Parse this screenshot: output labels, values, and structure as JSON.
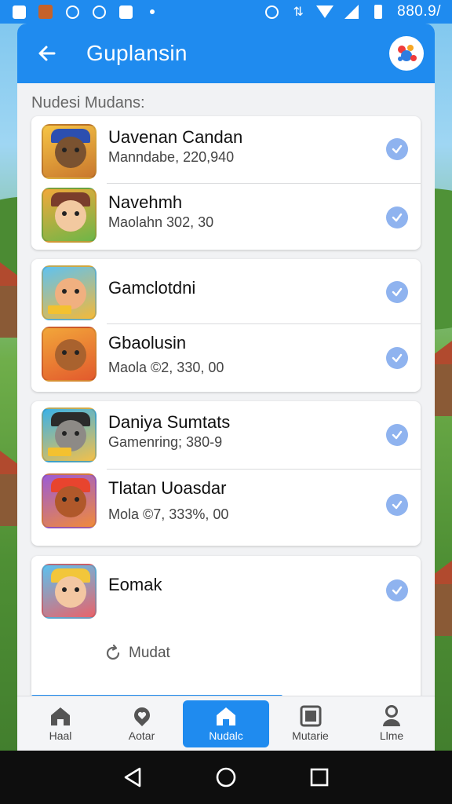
{
  "status_bar": {
    "time": "880.9/",
    "icons": [
      "image-icon",
      "app-icon",
      "sync-icon",
      "alarm-icon",
      "camera-icon",
      "dot-icon",
      "alarm-icon",
      "data-icon",
      "wifi-icon",
      "signal-icon",
      "battery-icon"
    ]
  },
  "header": {
    "title": "Guplansin",
    "back_icon": "arrow-left-icon",
    "logo_icon": "app-logo-icon"
  },
  "section_label": "Nudesi Mudans:",
  "groups": [
    {
      "items": [
        {
          "title": "Uavenan Candan",
          "subtitle": "Manndabe, 220,940",
          "thumb_color": "#6b4a2a",
          "checked": true
        },
        {
          "title": "Navehmh",
          "subtitle": "Maolahn 302, 30",
          "thumb_color": "#7a3d2b",
          "checked": true
        }
      ]
    },
    {
      "items": [
        {
          "title": "Gamclotdni",
          "subtitle": "",
          "thumb_color": "#e8a33a",
          "checked": true
        },
        {
          "title": "Gbaolusin",
          "subtitle": "Maola ©2, 330, 00",
          "thumb_color": "#c56a2c",
          "checked": true
        }
      ]
    },
    {
      "items": [
        {
          "title": "Daniya Sumtats",
          "subtitle": "Gamenring; 380-9",
          "thumb_color": "#3b6e9a",
          "checked": true
        },
        {
          "title": "Tlatan Uoasdar",
          "subtitle": "Mola ©7, 333%, 00",
          "thumb_color": "#8c3f22",
          "checked": true
        }
      ]
    },
    {
      "items": [
        {
          "title": "Eomak",
          "subtitle": "",
          "thumb_color": "#e29a4a",
          "checked": true
        }
      ],
      "more_label": "Mudat"
    }
  ],
  "bottom_nav": [
    {
      "label": "Haal",
      "icon": "home-icon",
      "active": false
    },
    {
      "label": "Aotar",
      "icon": "heart-location-icon",
      "active": false
    },
    {
      "label": "Nudalc",
      "icon": "home-icon",
      "active": true
    },
    {
      "label": "Mutarie",
      "icon": "gallery-icon",
      "active": false
    },
    {
      "label": "Llme",
      "icon": "profile-icon",
      "active": false
    }
  ],
  "system_nav": [
    "back-icon",
    "home-circle-icon",
    "recents-icon"
  ],
  "colors": {
    "accent": "#1f8bef",
    "check": "#8fb3ef",
    "card": "#ffffff",
    "panel": "#f1f2f4"
  }
}
